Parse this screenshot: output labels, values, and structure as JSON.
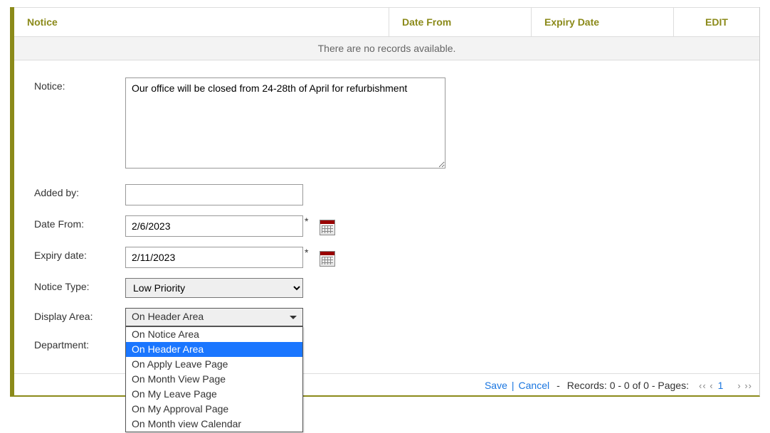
{
  "header": {
    "notice": "Notice",
    "dateFrom": "Date From",
    "expiry": "Expiry Date",
    "edit": "EDIT"
  },
  "noRecords": "There are no records available.",
  "labels": {
    "notice": "Notice:",
    "addedBy": "Added by:",
    "dateFrom": "Date From:",
    "expiryDate": "Expiry date:",
    "noticeType": "Notice Type:",
    "displayArea": "Display Area:",
    "department": "Department:"
  },
  "form": {
    "notice": "Our office will be closed from 24-28th of April for refurbishment",
    "addedBy": "",
    "dateFrom": "2/6/2023",
    "expiryDate": "2/11/2023",
    "noticeType": "Low Priority",
    "displayAreaSelected": "On Header Area",
    "requiredMark": "*",
    "displayAreaOptions": [
      "On Notice Area",
      "On Header Area",
      "On Apply Leave Page",
      "On Month View Page",
      "On My Leave Page",
      "On My Approval Page",
      "On Month view Calendar"
    ]
  },
  "footer": {
    "save": "Save",
    "bar": "|",
    "cancel": "Cancel",
    "dash": "-",
    "records": "Records: 0 - 0 of 0 - Pages:",
    "pagerLeft": "‹‹  ‹",
    "pageNum": "1",
    "pagerRight": "›  ››"
  }
}
